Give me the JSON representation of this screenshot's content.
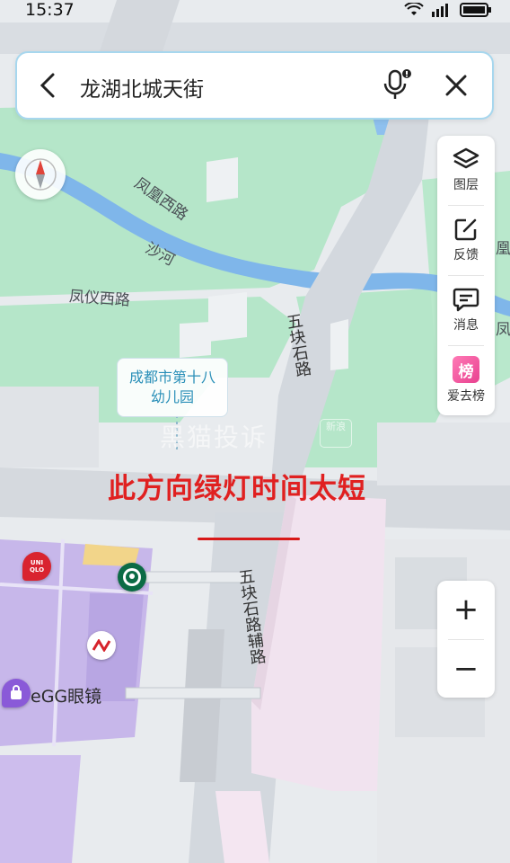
{
  "status_bar": {
    "time": "15:37"
  },
  "search": {
    "query": "龙湖北城天街"
  },
  "toolbar": {
    "items": [
      {
        "label": "图层",
        "icon": "layers-icon"
      },
      {
        "label": "反馈",
        "icon": "feedback-edit-icon"
      },
      {
        "label": "消息",
        "icon": "message-icon"
      },
      {
        "label": "爱去榜",
        "icon": "ranking-badge-icon",
        "badge_text": "榜"
      }
    ]
  },
  "zoom": {
    "in_label": "+",
    "out_label": "−"
  },
  "annotation": {
    "text": "此方向绿灯时间太短",
    "color": "#e02020"
  },
  "poi": {
    "line1": "成都市第十八",
    "line2": "幼儿园"
  },
  "map_labels": {
    "road_fenghuang_west": "凤凰西路",
    "river_sha": "沙河",
    "road_fengyi_west": "凤仪西路",
    "road_wukuaishi": "五块石路",
    "road_wukuaishi_side": "五块石路辅路",
    "road_right_edge_1": "凰",
    "road_right_edge_2": "凤",
    "egg_store": "eGG眼镜",
    "uniqlo": "UNI QLO"
  },
  "watermark": {
    "text": "黑猫投诉",
    "badge": "新浪"
  },
  "colors": {
    "park_green": "#b5e6c9",
    "river_blue": "#7fb6ea",
    "road_gray": "#d3d8de",
    "mall_purple": "#c7b7ea",
    "building_pink": "#f1e3ef",
    "accent_blue": "#2a8fb8"
  }
}
